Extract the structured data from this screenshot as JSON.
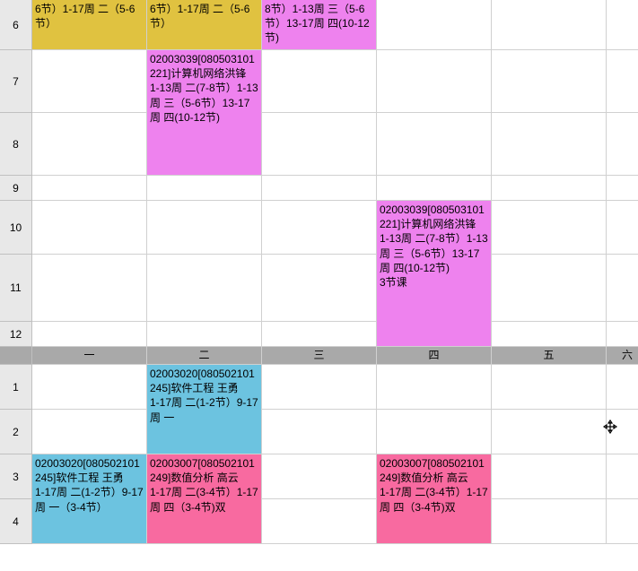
{
  "top": {
    "rows": [
      "6",
      "7",
      "8",
      "9",
      "10",
      "11",
      "12"
    ],
    "r6": {
      "c1": "6节）1-17周 二（5-6节）",
      "c2": "6节）1-17周 二（5-6节）",
      "c3": "8节）1-13周 三（5-6节）13-17周 四(10-12节)"
    },
    "course_78": "02003039[080503101221]计算机网络洪锋\n1-13周 二(7-8节）1-13周 三（5-6节）13-17周 四(10-12节)",
    "course_101112": "02003039[080503101221]计算机网络洪锋\n1-13周 二(7-8节）1-13周 三（5-6节）13-17周 四(10-12节)\n3节课"
  },
  "header": {
    "days": [
      "一",
      "二",
      "三",
      "四",
      "五",
      "六"
    ]
  },
  "bottom": {
    "rows": [
      "1",
      "2",
      "3",
      "4"
    ],
    "sw_12": "02003020[080502101245]软件工程 王勇\n1-17周 二(1-2节）9-17周 一",
    "sw_34": "02003020[080502101245]软件工程 王勇\n1-17周 二(1-2节）9-17周 一（3-4节）",
    "num_34_a": "02003007[080502101249]数值分析 高云\n1-17周 二(3-4节）1-17周 四（3-4节)双",
    "num_34_b": "02003007[080502101249]数值分析 高云\n1-17周 二(3-4节）1-17周 四（3-4节)双"
  },
  "cursor_glyph": "✥"
}
